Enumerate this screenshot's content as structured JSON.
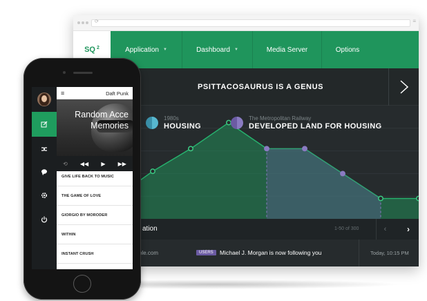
{
  "browser": {
    "logo": "SQ",
    "logo_sup": "2",
    "nav": [
      "Application",
      "Dashboard",
      "Media Server",
      "Options"
    ],
    "header_title": "PSITTACOSAURUS IS A GENUS",
    "legend": [
      {
        "sub": "1980s",
        "main": "HOUSING",
        "color": "#3a8fa8"
      },
      {
        "sub": "The Metropolitan Railway",
        "main": "DEVELOPED LAND FOR HOUSING",
        "color": "#6b5ba3"
      }
    ],
    "list_title": "ation",
    "pagination": "1-50 of 300",
    "activity": {
      "email": "ble.com",
      "badge": "USERS",
      "text": "Michael J. Morgan is now following you",
      "time": "Today, 10:15 PM"
    }
  },
  "chart_data": {
    "type": "area",
    "x": [
      1,
      2,
      3,
      4,
      5,
      6,
      7,
      8,
      9
    ],
    "series": [
      {
        "values": [
          18,
          42,
          62,
          85,
          62,
          62,
          40,
          18,
          18
        ],
        "color": "#1f955c"
      },
      {
        "values": [
          null,
          null,
          null,
          null,
          62,
          62,
          40,
          null,
          null
        ],
        "color": "#6b5ba3"
      }
    ],
    "ylim": [
      0,
      100
    ],
    "grid": true
  },
  "phone": {
    "artist": "Daft Punk",
    "album_title_line1": "Random Acce",
    "album_title_line2": "Memories",
    "tracks": [
      "GIVE LIFE BACK TO MUSIC",
      "THE GAME OF LOVE",
      "GIORGIO BY MORODER",
      "WITHIN",
      "INSTANT CRUSH"
    ],
    "sidebar_icons": [
      "edit-icon",
      "shuffle-icon",
      "chat-icon",
      "settings-icon",
      "power-icon"
    ]
  },
  "colors": {
    "accent": "#1f955c",
    "purple": "#6b5ba3",
    "dark": "#262b2d"
  }
}
